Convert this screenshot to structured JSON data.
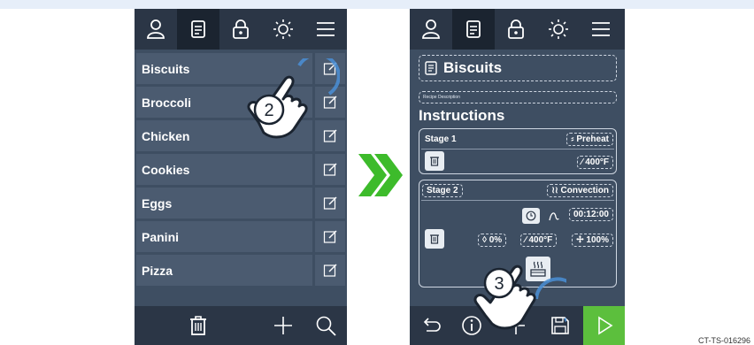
{
  "left_screen": {
    "recipes": [
      {
        "label": "Biscuits"
      },
      {
        "label": "Broccoli"
      },
      {
        "label": "Chicken"
      },
      {
        "label": "Cookies"
      },
      {
        "label": "Eggs"
      },
      {
        "label": "Panini"
      },
      {
        "label": "Pizza"
      }
    ]
  },
  "right_screen": {
    "recipe_title": "Biscuits",
    "description_placeholder": "Recipe Description",
    "section_title": "Instructions",
    "stage1": {
      "name": "Stage 1",
      "mode": "Preheat",
      "temperature": "400°F"
    },
    "stage2": {
      "name": "Stage 2",
      "mode": "Convection",
      "time": "00:12:00",
      "humidity": "0%",
      "temperature": "400°F",
      "fan": "100%"
    }
  },
  "steps": {
    "step2": "2",
    "step3": "3"
  },
  "caption": "CT-TS-016296",
  "colors": {
    "screen_bg": "#3e4e62",
    "nav_bg": "#2b3646",
    "row_bg": "#4b5b70",
    "accent_green": "#5cbf3d",
    "arrow_green": "#3dbb2b",
    "hand_ring": "#4a8fd6"
  }
}
